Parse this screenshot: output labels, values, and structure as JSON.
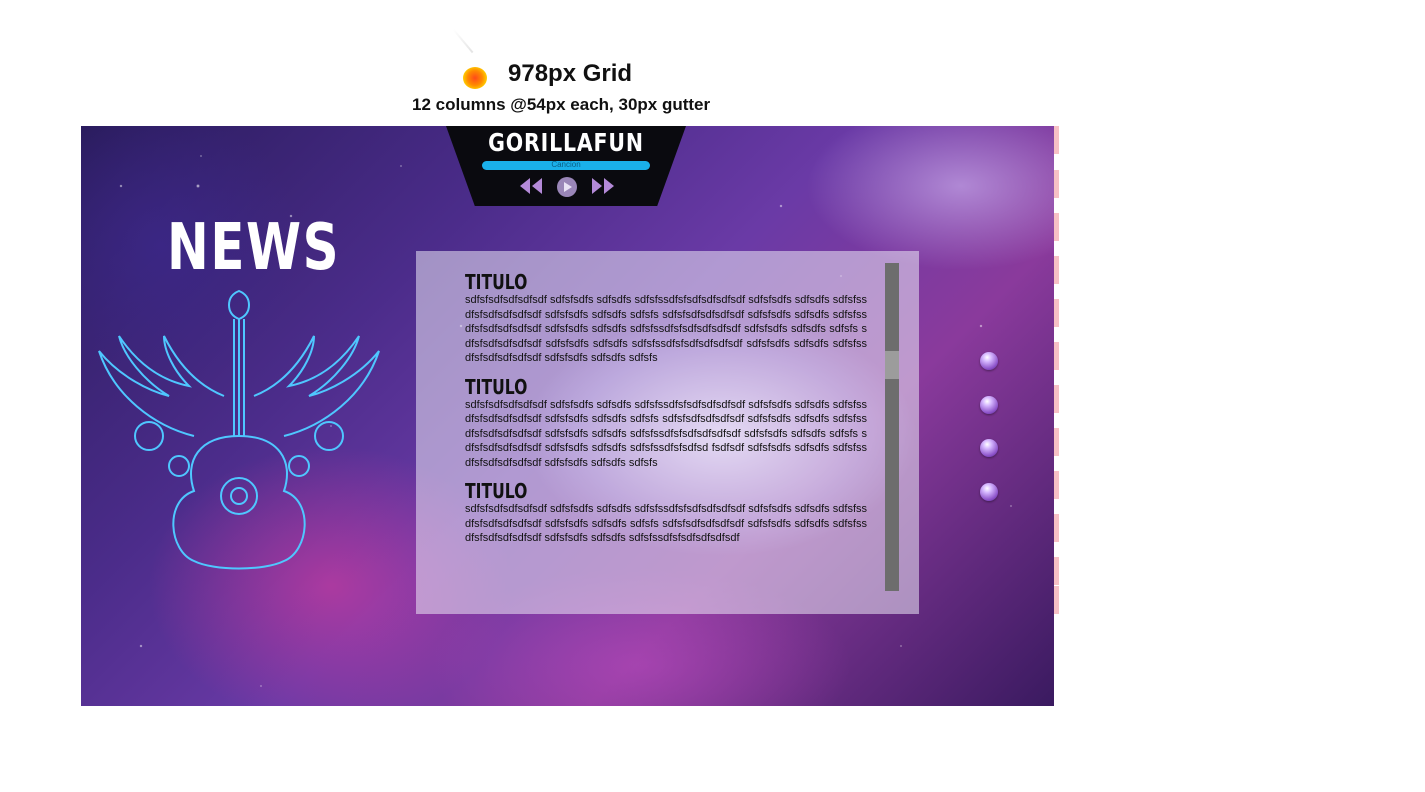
{
  "header": {
    "title": "978px Grid",
    "subtitle": "12 columns @54px each, 30px gutter"
  },
  "player": {
    "brand": "GORILLAFUN",
    "track_label": "Cancion",
    "icons": [
      "rewind-icon",
      "play-icon",
      "fast-forward-icon"
    ],
    "accent_color": "#1ab0ea"
  },
  "page": {
    "heading": "NEWS",
    "decoration": "winged-guitar-icon"
  },
  "articles": [
    {
      "title": "TITULO",
      "body": "sdfsfsdfsdfsdfsdf sdfsfsdfs sdfsdfs sdfsfssdfsfsdfsdfsdfsdf sdfsfsdfs sdfsdfs sdfsfssdfsfsdfsdfsdfsdf sdfsfsdfs sdfsdfs sdfsfs sdfsfsdfsdfsdfsdf sdfsfsdfs sdfsdfs sdfsfssdfsfsdfsdfsdfsdf sdfsfsdfs sdfsdfs sdfsfssdfsfsdfsdfsdfsdf sdfsfsdfs sdfsdfs sdfsfs sdfsfsdfsdfsdfsdf sdfsfsdfs sdfsdfs sdfsfssdfsfsdfsdfsdfsdf sdfsfsdfs sdfsdfs sdfsfssdfsfsdfsdfsdfsdf sdfsfsdfs sdfsdfs sdfsfs"
    },
    {
      "title": "TITULO",
      "body": "sdfsfsdfsdfsdfsdf sdfsfsdfs sdfsdfs sdfsfssdfsfsdfsdfsdfsdf sdfsfsdfs sdfsdfs sdfsfssdfsfsdfsdfsdfsdf sdfsfsdfs sdfsdfs sdfsfs sdfsfsdfsdfsdfsdf sdfsfsdfs sdfsdfs sdfsfssdfsfsdfsdfsdfsdf sdfsfsdfs sdfsdfs sdfsfssdfsfsdfsdfsdfsdf sdfsfsdfs sdfsdfs sdfsfs sdfsfsdfsdfsdfsdf sdfsfsdfs sdfsdfs sdfsfssdfsfsdfsd fsdfsdf sdfsfsdfs sdfsdfs sdfsfssdfsfsdfsdfsdfsdf sdfsfsdfs sdfsdfs sdfsfs"
    },
    {
      "title": "TITULO",
      "body": "sdfsfsdfsdfsdfsdf sdfsfsdfs sdfsdfs sdfsfssdfsfsdfsdfsdfsdf sdfsfsdfs sdfsdfs sdfsfssdfsfsdfsdfsdfsdf sdfsfsdfs sdfsdfs sdfsfs sdfsfsdfsdfsdfsdf sdfsfsdfs sdfsdfs sdfsfssdfsfsdfsdfsdfsdf sdfsfsdfs sdfsdfs sdfsfssdfsfsdfsdfsdfsdf"
    }
  ],
  "pager": {
    "count": 4,
    "icon": "bubble-nav-icon"
  }
}
